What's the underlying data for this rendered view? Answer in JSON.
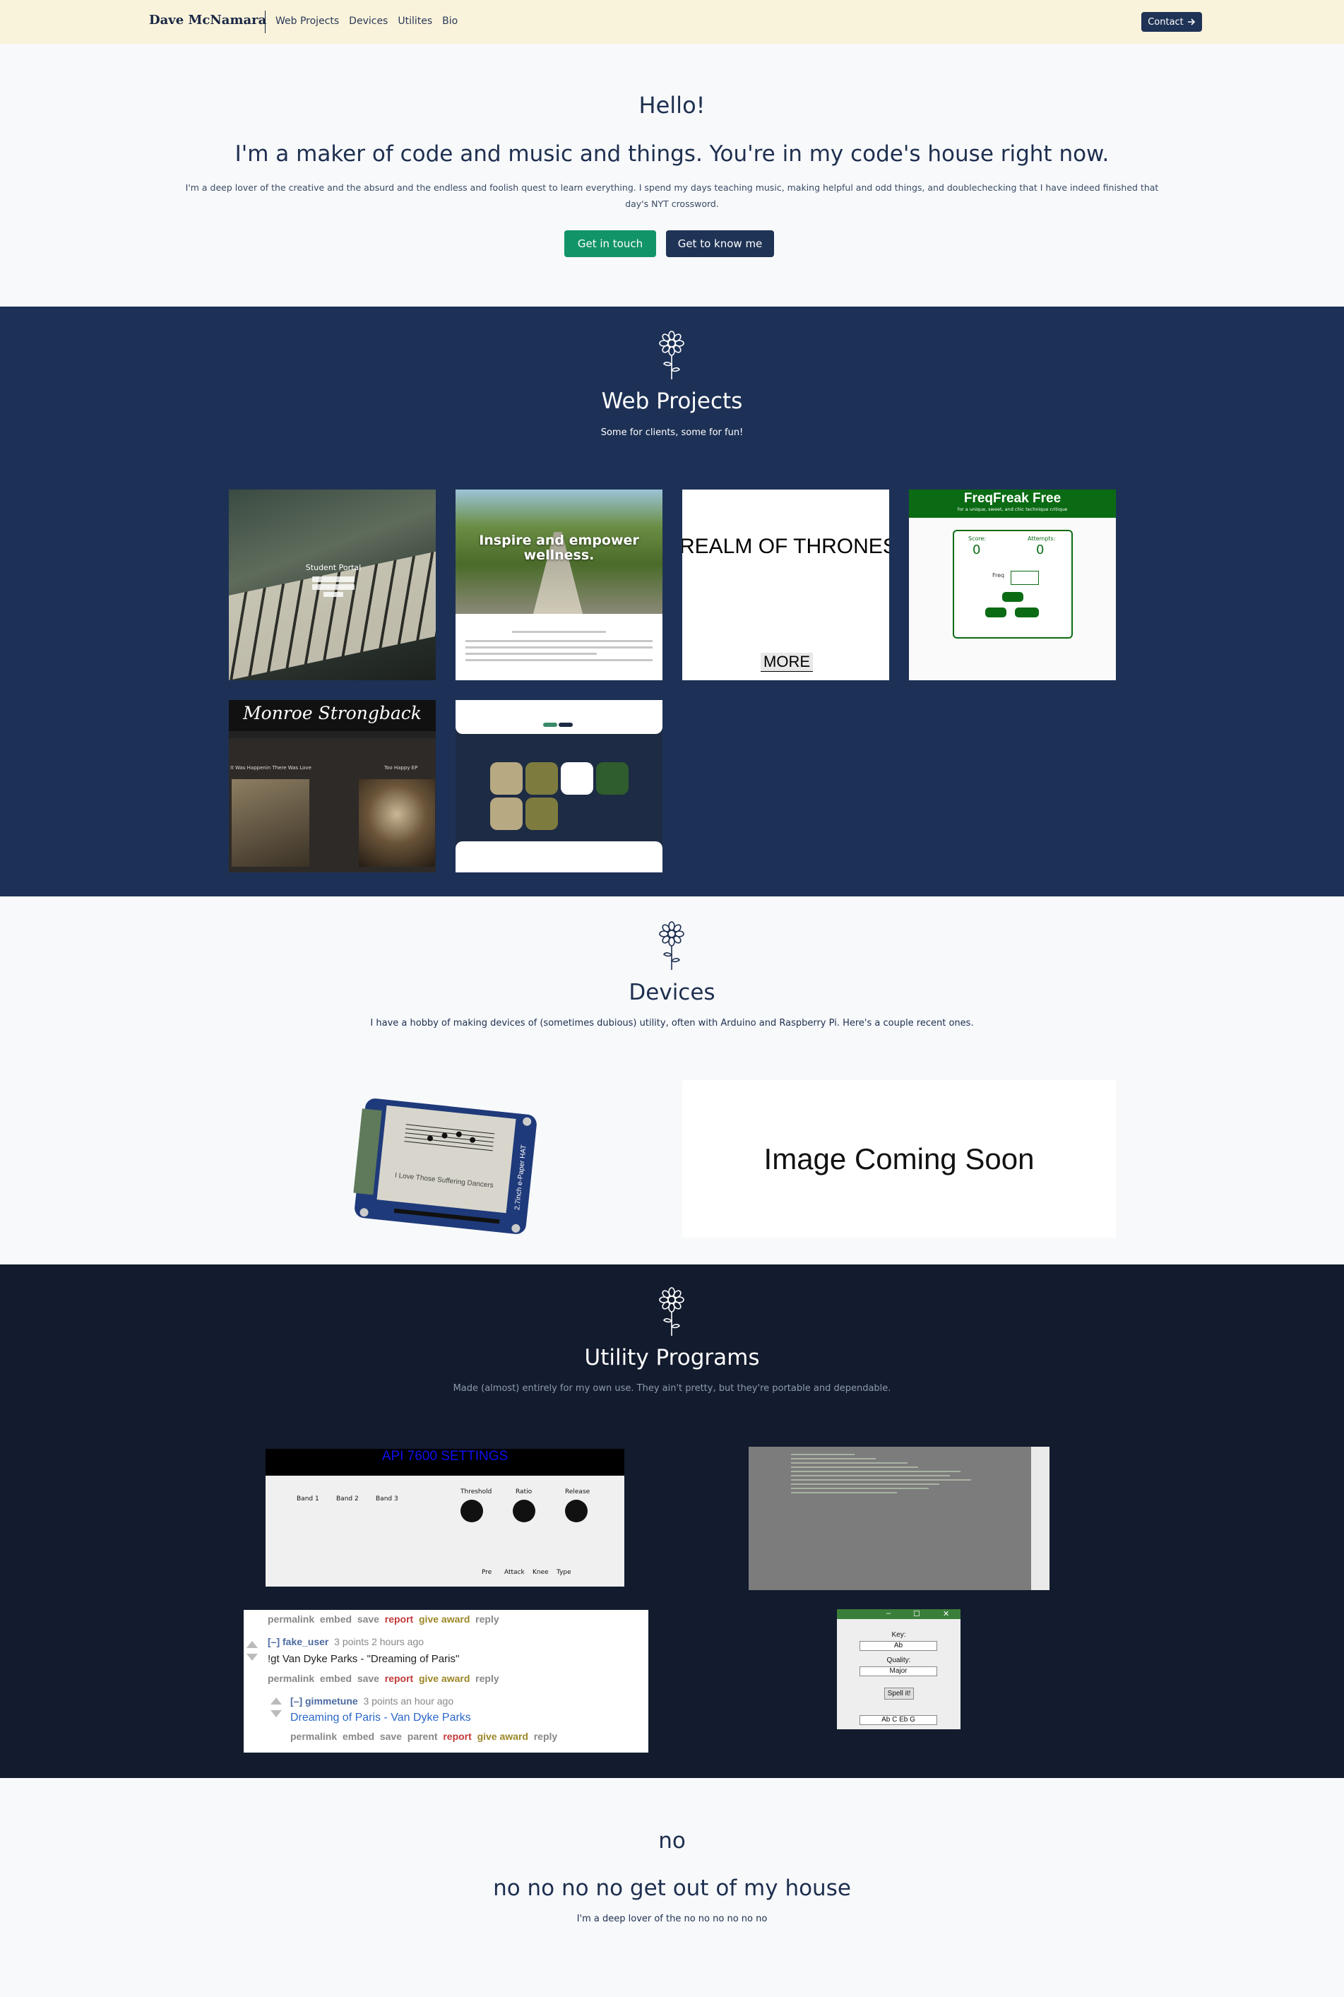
{
  "nav": {
    "brand": "Dave McNamara",
    "links": [
      "Web Projects",
      "Devices",
      "Utilites",
      "Bio"
    ],
    "contact_label": "Contact",
    "contact_icon": "arrow-right-icon"
  },
  "hero": {
    "greeting": "Hello!",
    "title": "I'm a maker of code and music and things. You're in my code's house right now.",
    "subtitle": "I'm a deep lover of the creative and the absurd and the endless and foolish quest to learn everything. I spend my days teaching music, making helpful and odd things, and doublechecking that I have indeed finished that day's NYT crossword.",
    "primary_button": "Get in touch",
    "secondary_button": "Get to know me"
  },
  "web_projects": {
    "title": "Web Projects",
    "subtitle": "Some for clients, some for fun!",
    "cards": {
      "student_portal": {
        "caption": "Student Portal"
      },
      "wellness": {
        "headline": "Inspire and empower wellness."
      },
      "realm": {
        "title": "REALM OF THRONES",
        "more": "MORE"
      },
      "freqfreak": {
        "title": "FreqFreak Free",
        "tagline": "for a unique, sweet, and chic technique critique",
        "score_label": "Score:",
        "score_value": "0",
        "attempts_label": "Attempts:",
        "attempts_value": "0",
        "freq_label": "Freq"
      },
      "monroe": {
        "title": "Monroe Strongback",
        "left_label": "It Was Happenin There Was Love",
        "right_label": "Too Happy EP"
      }
    }
  },
  "devices": {
    "title": "Devices",
    "subtitle": "I have a hobby of making devices of (sometimes dubious) utility, often with Arduino and Raspberry Pi. Here's a couple recent ones.",
    "eink_screen_text": "I Love Those Suffering Dancers",
    "eink_label": "2.7inch e-Paper HAT",
    "coming_soon": "Image Coming Soon"
  },
  "utilities": {
    "title": "Utility Programs",
    "subtitle": "Made (almost) entirely for my own use. They ain't pretty, but they're portable and dependable.",
    "api": {
      "title": "API 7600 SETTINGS",
      "bands": [
        "Band 1",
        "Band 2",
        "Band 3"
      ],
      "knobs": [
        "Threshold",
        "Ratio",
        "Release"
      ],
      "bottom_labels": [
        "Pre",
        "Attack",
        "Knee",
        "Type"
      ]
    },
    "reddit": {
      "actions_1": [
        "permalink",
        "embed",
        "save",
        "report",
        "give award",
        "reply"
      ],
      "user_1": "[–] fake_user",
      "meta_1": "3 points 2 hours ago",
      "body_1": "!gt Van Dyke Parks - \"Dreaming of Paris\"",
      "actions_2": [
        "permalink",
        "embed",
        "save",
        "report",
        "give award",
        "reply"
      ],
      "user_2": "[–] gimmetune",
      "meta_2": "3 points an hour ago",
      "link_2": "Dreaming of Paris - Van Dyke Parks",
      "actions_3": [
        "permalink",
        "embed",
        "save",
        "parent",
        "report",
        "give award",
        "reply"
      ]
    },
    "speller": {
      "key_label": "Key:",
      "key_value": "Ab",
      "quality_label": "Quality:",
      "quality_value": "Major",
      "button": "Spell it!",
      "result": "Ab C Eb G"
    }
  },
  "no": {
    "greeting": "no",
    "title": "no no no no get out of my house",
    "subtitle": "I'm a deep lover of the no no no no no no"
  },
  "colors": {
    "navbar_bg": "#faf3db",
    "navy": "#1d3156",
    "dark": "#131b2e",
    "green_button": "#129469",
    "light_bg": "#f7f9fb"
  }
}
